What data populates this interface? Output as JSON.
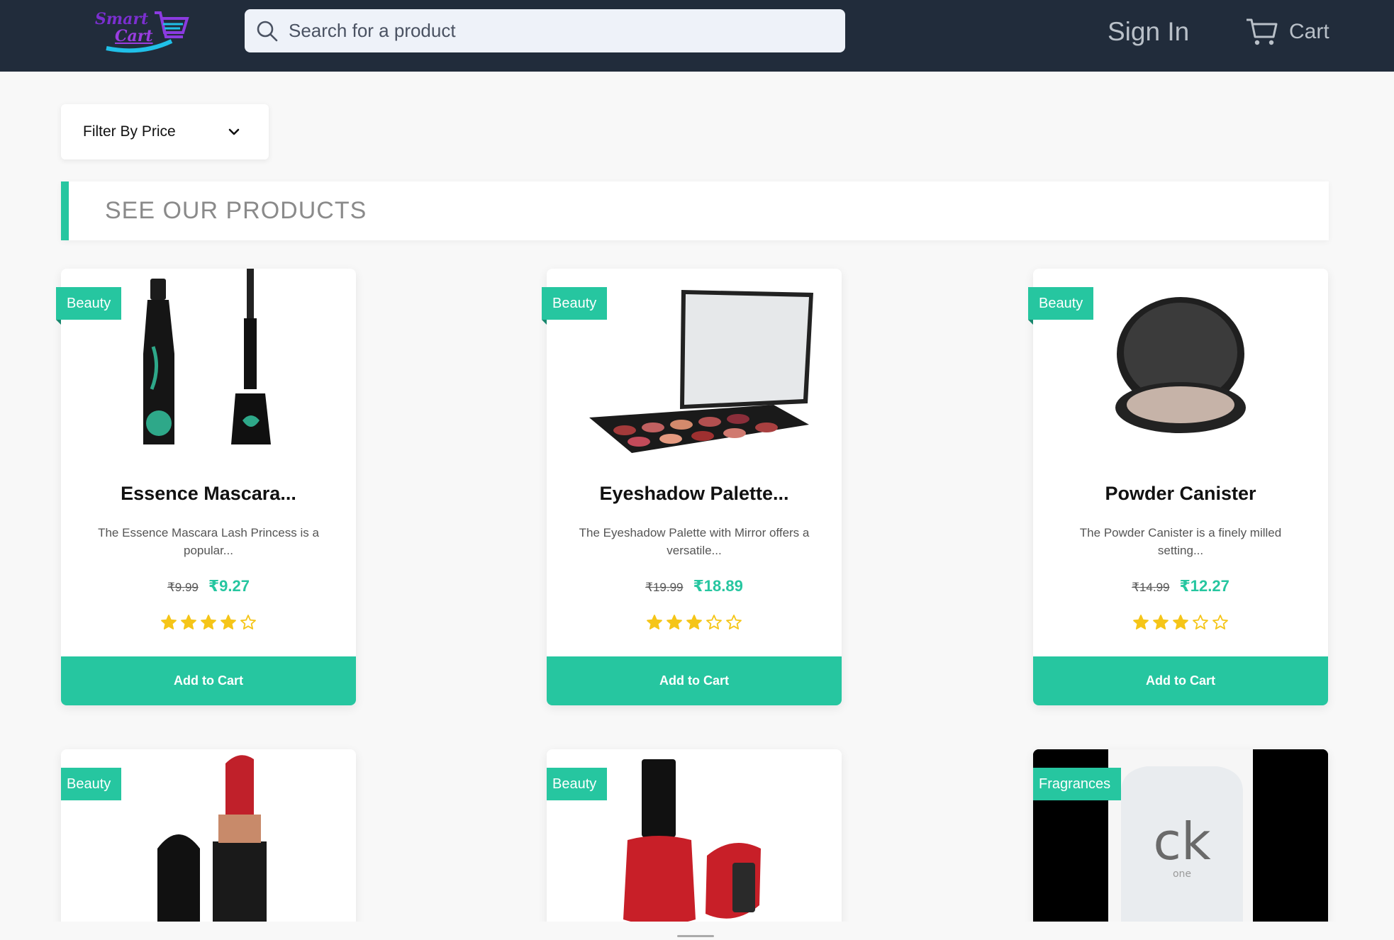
{
  "header": {
    "logo_line1": "Smart",
    "logo_line2": "Cart",
    "search_placeholder": "Search for a product",
    "sign_in": "Sign In",
    "cart": "Cart"
  },
  "filter": {
    "label": "Filter By Price"
  },
  "section": {
    "title": "SEE OUR PRODUCTS"
  },
  "colors": {
    "accent": "#26c6a0",
    "header_bg": "#212c3b",
    "star": "#f5c518"
  },
  "products": [
    {
      "category": "Beauty",
      "title": "Essence Mascara...",
      "description": "The Essence Mascara Lash Princess is a popular...",
      "old_price": "₹9.99",
      "price": "₹9.27",
      "rating": 4,
      "button": "Add to Cart"
    },
    {
      "category": "Beauty",
      "title": "Eyeshadow Palette...",
      "description": "The Eyeshadow Palette with Mirror offers a versatile...",
      "old_price": "₹19.99",
      "price": "₹18.89",
      "rating": 3,
      "button": "Add to Cart"
    },
    {
      "category": "Beauty",
      "title": "Powder Canister",
      "description": "The Powder Canister is a finely milled setting...",
      "old_price": "₹14.99",
      "price": "₹12.27",
      "rating": 3,
      "button": "Add to Cart"
    },
    {
      "category": "Beauty"
    },
    {
      "category": "Beauty"
    },
    {
      "category": "Fragrances",
      "image_text": "ck",
      "image_subtext": "one"
    }
  ]
}
